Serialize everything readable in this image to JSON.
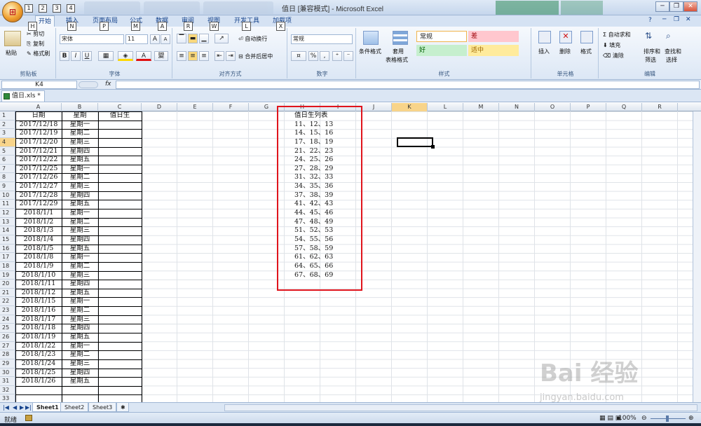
{
  "window": {
    "title": "值日 [兼容模式] - Microsoft Excel",
    "buttons": {
      "minimize": "─",
      "restore": "❐",
      "close": "✕",
      "ribbon_min": "─",
      "ribbon_restore": "❐",
      "ribbon_close": "✕",
      "help": "?"
    }
  },
  "keytips": {
    "qat": [
      "1",
      "2",
      "3",
      "4"
    ],
    "tabs": [
      "H",
      "N",
      "P",
      "M",
      "A",
      "R",
      "W",
      "L",
      "X"
    ]
  },
  "tabs": [
    "开始",
    "插入",
    "页面布局",
    "公式",
    "数据",
    "审阅",
    "视图",
    "开发工具",
    "加载项"
  ],
  "ribbon": {
    "clipboard": {
      "label": "剪贴板",
      "paste": "粘贴",
      "cut": "剪切",
      "copy": "复制",
      "painter": "格式刷"
    },
    "font": {
      "label": "字体",
      "name": "宋体",
      "size": "11",
      "grow": "A",
      "shrink": "A",
      "bold": "B",
      "italic": "I",
      "underline": "U",
      "wen": "變"
    },
    "align": {
      "label": "对齐方式",
      "wrap": "自动换行",
      "merge": "合并后居中"
    },
    "number": {
      "label": "数字",
      "format": "常规",
      "percent": "%",
      "comma": ","
    },
    "styles": {
      "label": "样式",
      "conditional": "条件格式",
      "table": "套用",
      "table2": "表格格式",
      "normal": "常规",
      "bad": "差",
      "good": "好",
      "neutral": "适中"
    },
    "cells": {
      "label": "单元格",
      "insert": "插入",
      "delete": "删除",
      "format": "格式"
    },
    "editing": {
      "label": "编辑",
      "autosum": "自动求和",
      "fill": "填充",
      "clear": "清除",
      "sort": "排序和",
      "sort2": "筛选",
      "find": "查找和",
      "find2": "选择"
    }
  },
  "formula_bar": {
    "name_box": "K4",
    "fx": "fx",
    "value": ""
  },
  "document_tab": "值日.xls *",
  "columns": [
    "A",
    "B",
    "C",
    "D",
    "E",
    "F",
    "G",
    "H",
    "I",
    "J",
    "K",
    "L",
    "M",
    "N",
    "O",
    "P",
    "Q",
    "R"
  ],
  "rows": [
    "1",
    "2",
    "3",
    "4",
    "5",
    "6",
    "7",
    "8",
    "9",
    "10",
    "11",
    "12",
    "13",
    "14",
    "15",
    "16",
    "17",
    "18",
    "19",
    "20",
    "21",
    "22",
    "23",
    "24",
    "25",
    "26",
    "27",
    "28",
    "29",
    "30",
    "31",
    "32",
    "33"
  ],
  "table": {
    "headers": [
      "日期",
      "星期",
      "值日生"
    ],
    "dates": [
      "2017/12/18",
      "2017/12/19",
      "2017/12/20",
      "2017/12/21",
      "2017/12/22",
      "2017/12/25",
      "2017/12/26",
      "2017/12/27",
      "2017/12/28",
      "2017/12/29",
      "2018/1/1",
      "2018/1/2",
      "2018/1/3",
      "2018/1/4",
      "2018/1/5",
      "2018/1/8",
      "2018/1/9",
      "2018/1/10",
      "2018/1/11",
      "2018/1/12",
      "2018/1/15",
      "2018/1/16",
      "2018/1/17",
      "2018/1/18",
      "2018/1/19",
      "2018/1/22",
      "2018/1/23",
      "2018/1/24",
      "2018/1/25",
      "2018/1/26"
    ],
    "weekdays": [
      "星期一",
      "星期二",
      "星期三",
      "星期四",
      "星期五",
      "星期一",
      "星期二",
      "星期三",
      "星期四",
      "星期五",
      "星期一",
      "星期二",
      "星期三",
      "星期四",
      "星期五",
      "星期一",
      "星期二",
      "星期三",
      "星期四",
      "星期五",
      "星期一",
      "星期二",
      "星期三",
      "星期四",
      "星期五",
      "星期一",
      "星期二",
      "星期三",
      "星期四",
      "星期五"
    ]
  },
  "duty_list": {
    "header": "值日生列表",
    "items": [
      "11、12、13",
      "14、15、16",
      "17、18、19",
      "21、22、23",
      "24、25、26",
      "27、28、29",
      "31、32、33",
      "34、35、36",
      "37、38、39",
      "41、42、43",
      "44、45、46",
      "47、48、49",
      "51、52、53",
      "54、55、56",
      "57、58、59",
      "61、62、63",
      "64、65、66",
      "67、68、69"
    ]
  },
  "sheets": [
    "Sheet1",
    "Sheet2",
    "Sheet3"
  ],
  "status": {
    "ready": "就绪",
    "zoom": "100%"
  },
  "watermark": {
    "brand": "Bai 经验",
    "url": "jingyan.baidu.com"
  },
  "colors": {
    "accent": "#15428b",
    "red_box": "#e0141c",
    "bad": "#ffc7ce",
    "good": "#c6efce",
    "neutral": "#ffeb9c"
  }
}
